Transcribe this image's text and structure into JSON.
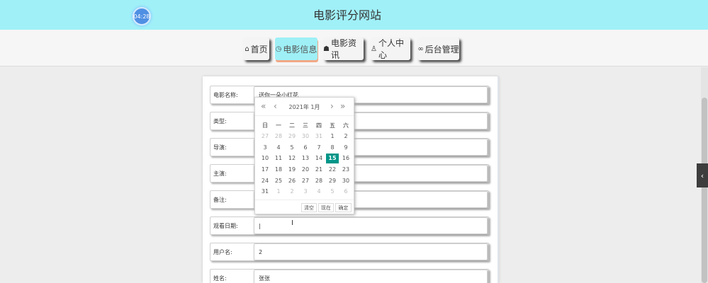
{
  "header": {
    "clock": "04:28",
    "site_title": "电影评分网站"
  },
  "nav": [
    {
      "label": "首页",
      "icon": "⌂",
      "active": false
    },
    {
      "label": "电影信息",
      "icon": "◷",
      "active": true
    },
    {
      "label": "电影资讯",
      "icon": "☗",
      "active": false
    },
    {
      "label": "个人中心",
      "icon": "♙",
      "active": false
    },
    {
      "label": "后台管理",
      "icon": "∞",
      "active": false
    }
  ],
  "form": {
    "rows": [
      {
        "label": "电影名称:",
        "value": "送你一朵小红花"
      },
      {
        "label": "类型:",
        "value": ""
      },
      {
        "label": "导演:",
        "value": ""
      },
      {
        "label": "主演:",
        "value": ""
      },
      {
        "label": "备注:",
        "value": ""
      },
      {
        "label": "观看日期:",
        "value": "|"
      },
      {
        "label": "用户名:",
        "value": "2"
      },
      {
        "label": "姓名:",
        "value": "张张"
      }
    ]
  },
  "datepicker": {
    "title": "2021年  1月",
    "weekdays": [
      "日",
      "一",
      "二",
      "三",
      "四",
      "五",
      "六"
    ],
    "weeks": [
      [
        "27",
        "28",
        "29",
        "30",
        "31",
        "1",
        "2"
      ],
      [
        "3",
        "4",
        "5",
        "6",
        "7",
        "8",
        "9"
      ],
      [
        "10",
        "11",
        "12",
        "13",
        "14",
        "15",
        "16"
      ],
      [
        "17",
        "18",
        "19",
        "20",
        "21",
        "22",
        "23"
      ],
      [
        "24",
        "25",
        "26",
        "27",
        "28",
        "29",
        "30"
      ],
      [
        "31",
        "1",
        "2",
        "3",
        "4",
        "5",
        "6"
      ]
    ],
    "selected": "15",
    "buttons": {
      "clear": "清空",
      "now": "现在",
      "confirm": "确定"
    },
    "nav_icons": {
      "prev_year": "«",
      "prev_month": "‹",
      "next_month": "›",
      "next_year": "»"
    }
  },
  "side_toggle_icon": "‹"
}
